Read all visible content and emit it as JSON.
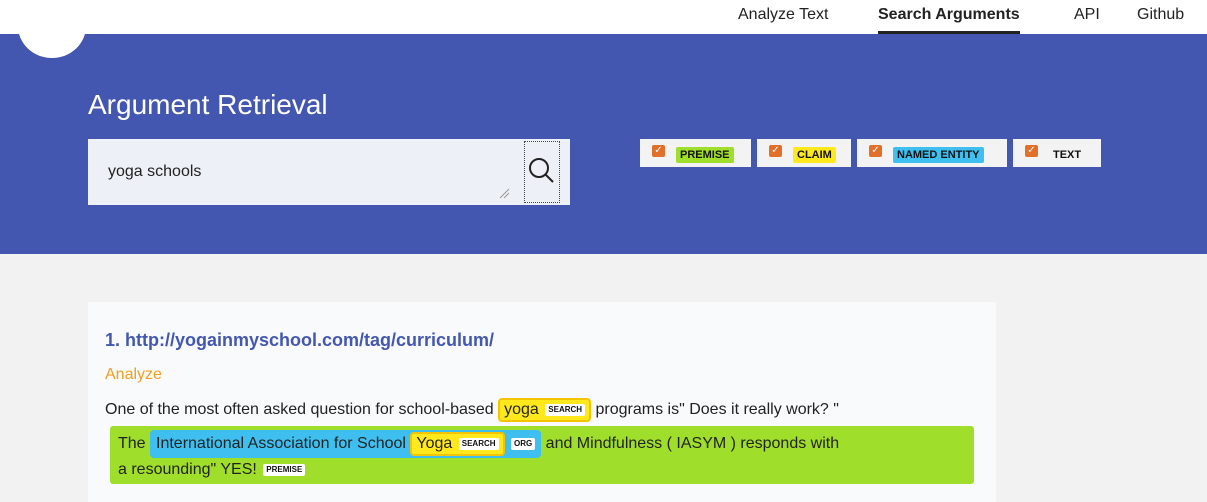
{
  "nav": {
    "items": [
      {
        "label": "Analyze Text"
      },
      {
        "label": "Search Arguments"
      },
      {
        "label": "API"
      },
      {
        "label": "Github"
      }
    ],
    "active": "Search Arguments"
  },
  "banner": {
    "title": "Argument Retrieval",
    "search": {
      "value": "yoga schools"
    },
    "icon": "search-icon"
  },
  "filters": [
    {
      "label": "PREMISE",
      "checked": true,
      "color": "#9fde2a"
    },
    {
      "label": "CLAIM",
      "checked": true,
      "color": "#ffe81c"
    },
    {
      "label": "NAMED ENTITY",
      "checked": true,
      "color": "#3fbfef"
    },
    {
      "label": "TEXT",
      "checked": true,
      "color": "none"
    }
  ],
  "colors": {
    "banner": "#4457b0",
    "link": "#4457b0",
    "analyze": "#f0a01a",
    "checkbox": "#e0702a"
  },
  "results": [
    {
      "title": "1. http://yogainmyschool.com/tag/curriculum/",
      "analyze_label": "Analyze",
      "line1": {
        "before": "One of the most often asked question for school-based ",
        "highlight": "yoga",
        "badge": "SEARCH",
        "after": " programs is\" Does it really work? \""
      },
      "premise": {
        "prefix": "The ",
        "entity_before": "International Association for School ",
        "entity_highlight": "Yoga",
        "search_badge": "SEARCH",
        "entity_badge": "ORG",
        "after": " and Mindfulness ( IASYM ) responds with",
        "line2": "a resounding\" YES!",
        "badge": "PREMISE"
      }
    }
  ]
}
